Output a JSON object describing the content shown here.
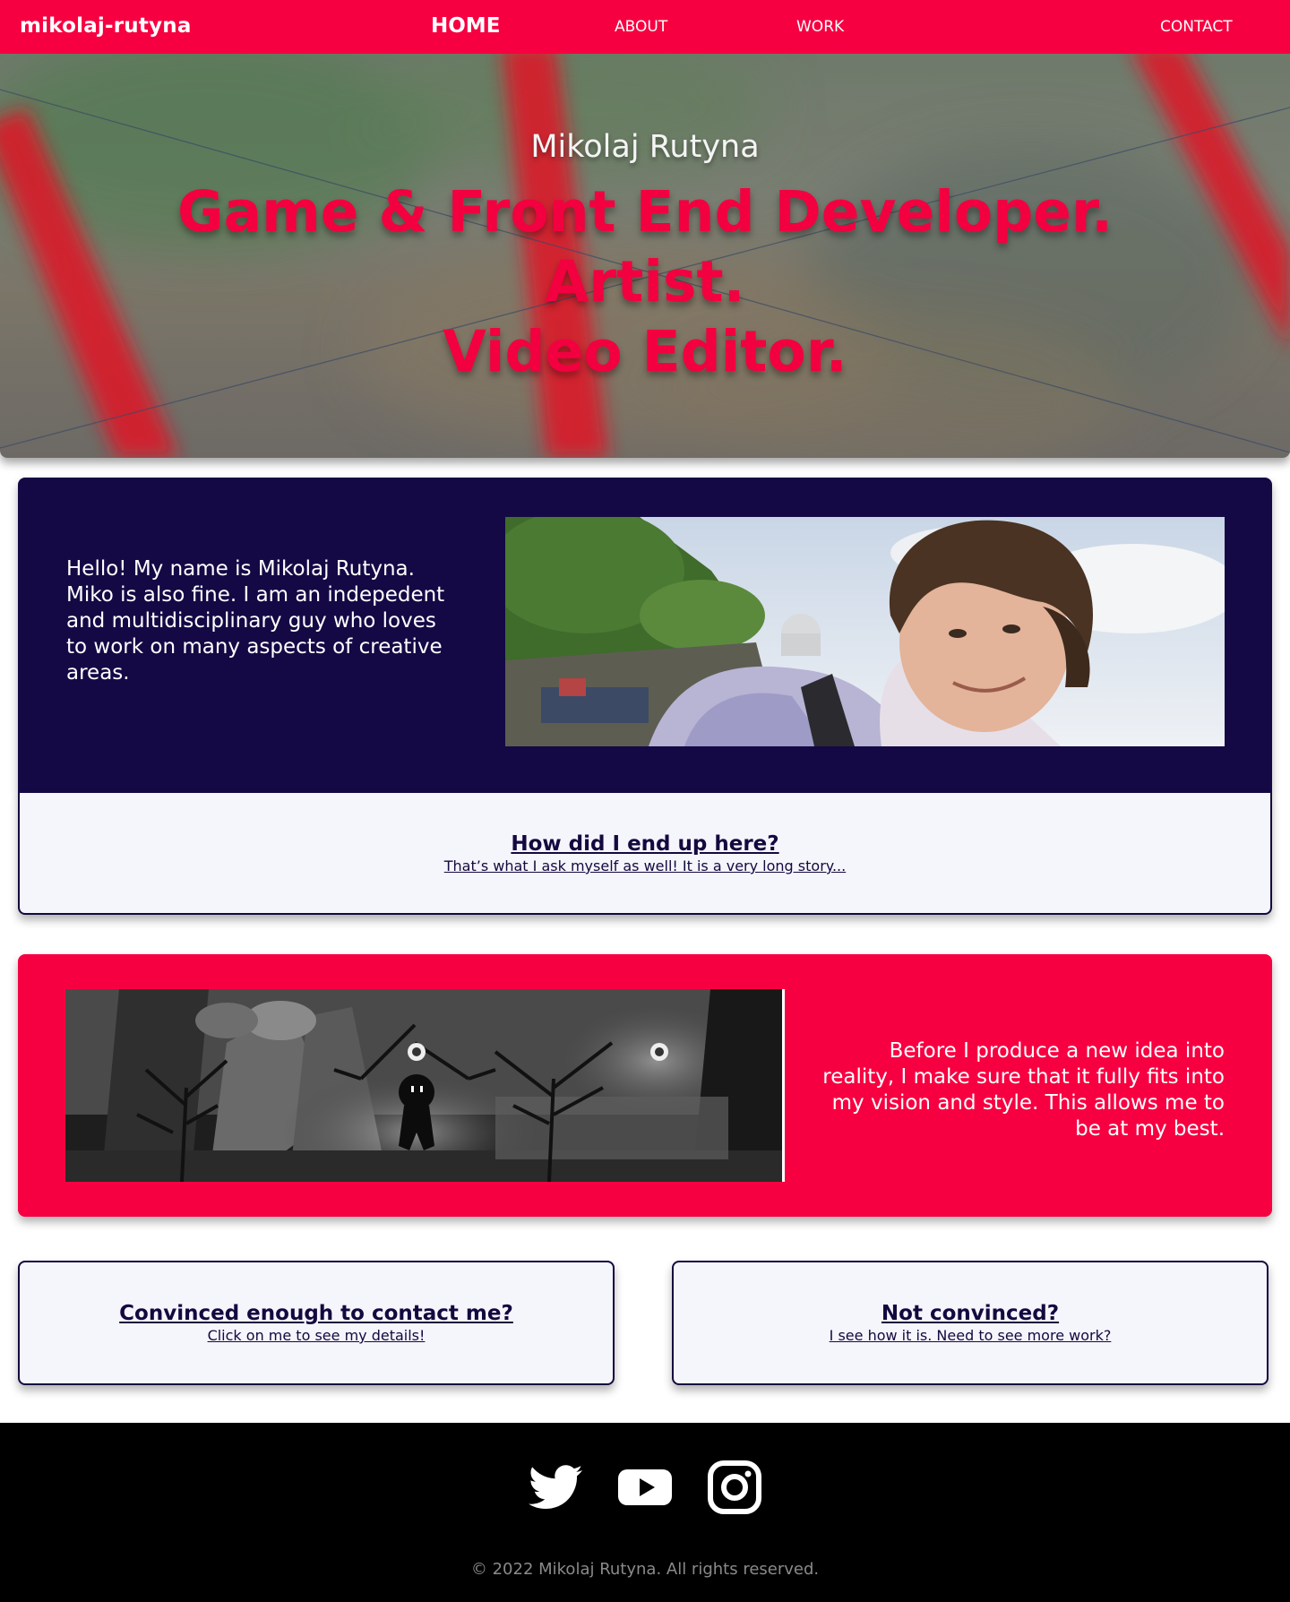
{
  "nav": {
    "logo": "mikolaj-rutyna",
    "home": "HOME",
    "about": "ABOUT",
    "work": "WORK",
    "contact": "CONTACT"
  },
  "hero": {
    "name": "Mikolaj Rutyna",
    "roles": [
      "Game & Front End Developer.",
      "Artist.",
      "Video Editor."
    ]
  },
  "about": {
    "intro": "Hello! My name is Mikolaj Rutyna. Miko is also fine. I am an indepedent and multidisciplinary guy who loves to work on many aspects of creative areas.",
    "cta_title": "How did I end up here?",
    "cta_sub": "That’s what I ask myself as well! It is a very long story..."
  },
  "philosophy": {
    "text": "Before I produce a new idea into reality, I make sure that it fully fits into my vision and style. This allows me to be at my best."
  },
  "cta_contact": {
    "title": "Convinced enough to contact me?",
    "sub": "Click on me to see my details!"
  },
  "cta_work": {
    "title": "Not convinced?",
    "sub": "I see how it is. Need to see more work?"
  },
  "footer": {
    "icons": [
      "twitter-icon",
      "youtube-icon",
      "instagram-icon"
    ],
    "copyright": "© 2022 Mikolaj Rutyna. All rights reserved."
  },
  "colors": {
    "accent": "#f70041",
    "navy": "#140945",
    "light_card": "#f5f5fc",
    "footer": "#000000"
  }
}
